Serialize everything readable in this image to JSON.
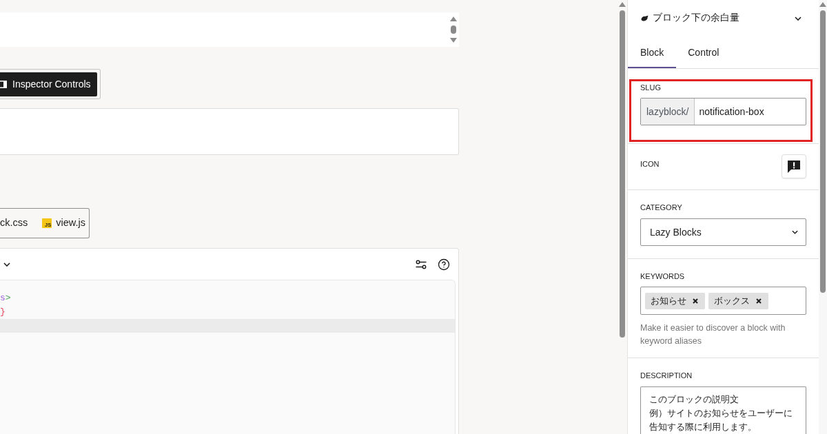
{
  "editor": {
    "inspector_button": {
      "label": "Inspector Controls"
    },
    "file_tabs": [
      {
        "label": "ck.css"
      },
      {
        "badge": "JS",
        "label": "view.js"
      }
    ],
    "code_panel": {
      "lines": [
        {
          "current": false,
          "tokens": [
            {
              "kind": "tag",
              "text": "s"
            },
            {
              "kind": "punct",
              "text": ">"
            }
          ]
        },
        {
          "current": false,
          "tokens": [
            {
              "kind": "brace",
              "text": "}"
            }
          ]
        },
        {
          "current": true
        }
      ]
    }
  },
  "sidebar": {
    "block_title": "ブロック下の余白量",
    "tabs": [
      {
        "label": "Block",
        "selected": true
      },
      {
        "label": "Control",
        "selected": false
      }
    ],
    "fields": [
      {
        "kind": "slug",
        "label": "SLUG",
        "prefix": "lazyblock/",
        "value": "notification-box",
        "highlighted": true
      },
      {
        "kind": "icon",
        "label": "ICON"
      },
      {
        "kind": "select",
        "label": "CATEGORY",
        "value": "Lazy Blocks"
      },
      {
        "kind": "tokens",
        "label": "KEYWORDS",
        "tokens": [
          "お知らせ",
          "ボックス"
        ],
        "help": "Make it easier to discover a block with keyword aliases"
      },
      {
        "kind": "textarea",
        "label": "DESCRIPTION",
        "lines": [
          "このブロックの説明文",
          "例）サイトのお知らせをユーザーに告知する際に利用します。"
        ]
      }
    ]
  }
}
